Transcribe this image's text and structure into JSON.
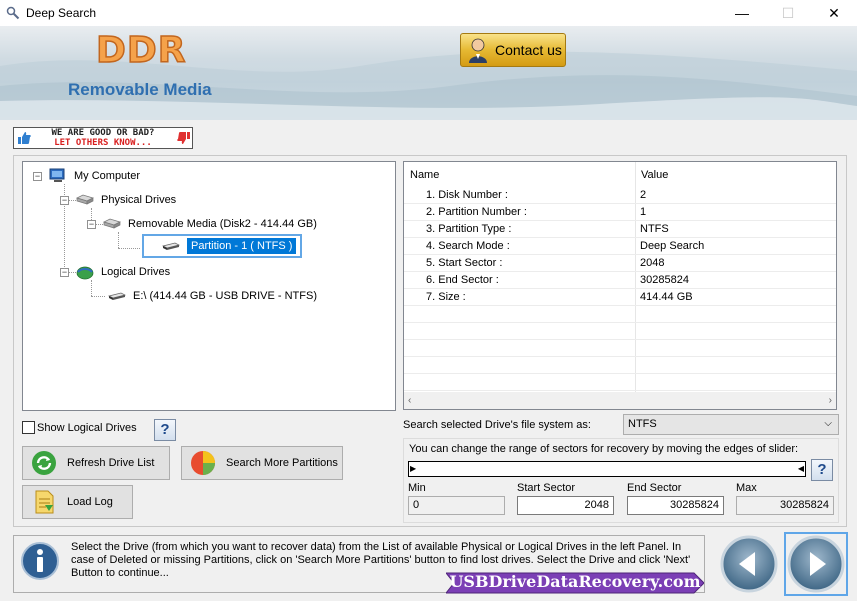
{
  "window": {
    "title": "Deep Search",
    "controls": {
      "minimize": "—",
      "maximize": "☐",
      "close": "✕"
    }
  },
  "header": {
    "brand": "DDR",
    "subtitle": "Removable Media",
    "contact_label": "Contact us"
  },
  "feedback": {
    "line1": "WE ARE GOOD OR BAD?",
    "line2": "LET OTHERS KNOW..."
  },
  "tree": {
    "root": "My Computer",
    "physical_drives": "Physical Drives",
    "removable_media": "Removable Media (Disk2 - 414.44 GB)",
    "partition": "Partition - 1 ( NTFS )",
    "logical_drives": "Logical Drives",
    "logical_drive_e": "E:\\ (414.44 GB - USB DRIVE - NTFS)"
  },
  "properties": {
    "headers": {
      "name": "Name",
      "value": "Value"
    },
    "rows": [
      {
        "name": "1. Disk Number :",
        "value": "2"
      },
      {
        "name": "2. Partition Number :",
        "value": "1"
      },
      {
        "name": "3. Partition Type :",
        "value": "NTFS"
      },
      {
        "name": "4. Search Mode :",
        "value": "Deep Search"
      },
      {
        "name": "5. Start Sector :",
        "value": "2048"
      },
      {
        "name": "6. End Sector :",
        "value": "30285824"
      },
      {
        "name": "7. Size :",
        "value": "414.44 GB"
      }
    ],
    "scroll_left": "‹",
    "scroll_right": "›"
  },
  "left_controls": {
    "show_logical_label": "Show Logical Drives",
    "help": "?",
    "refresh_label": "Refresh Drive List",
    "search_more_label": "Search More Partitions",
    "load_log_label": "Load Log"
  },
  "search_fs": {
    "label": "Search selected Drive's file system as:",
    "value": "NTFS",
    "caret": "⌵"
  },
  "range": {
    "description": "You can change the range of sectors for recovery by moving the edges of slider:",
    "help": "?",
    "min_label": "Min",
    "min_value": "0",
    "start_label": "Start Sector",
    "start_value": "2048",
    "end_label": "End Sector",
    "end_value": "30285824",
    "max_label": "Max",
    "max_value": "30285824"
  },
  "info": {
    "text": "Select the Drive (from which you want to recover data) from the List of available Physical or Logical Drives in the left Panel. In case of Deleted or missing Partitions, click on 'Search More Partitions' button to find lost drives. Select the Drive and click 'Next' Button to continue...",
    "site": "USBDriveDataRecovery.com"
  },
  "colors": {
    "selection": "#0078d7",
    "brand_orange": "#f5a24a",
    "subtitle_blue": "#2f6fb0",
    "badge_purple": "#7b3fb5"
  }
}
